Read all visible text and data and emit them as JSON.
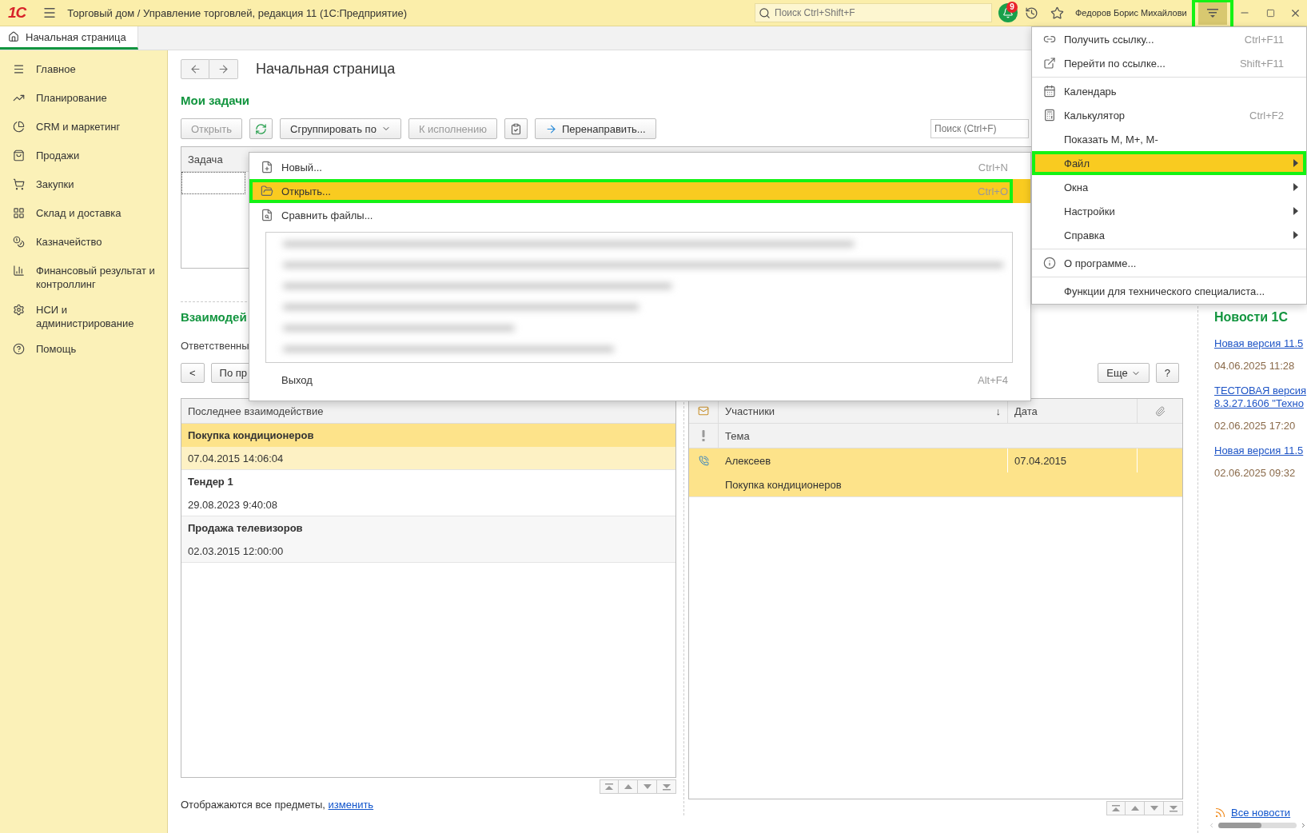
{
  "titlebar": {
    "logo": "1С",
    "title": "Торговый дом / Управление торговлей, редакция 11  (1С:Предприятие)",
    "search": {
      "placeholder": "Поиск Ctrl+Shift+F"
    },
    "notifications": "9",
    "user": "Федоров Борис Михайлови",
    "main_menu_highlighted": true
  },
  "tabs": [
    {
      "label": "Начальная страница",
      "selected": true
    }
  ],
  "sidebar": {
    "items": [
      {
        "label": "Главное"
      },
      {
        "label": "Планирование"
      },
      {
        "label": "CRM и маркетинг"
      },
      {
        "label": "Продажи"
      },
      {
        "label": "Закупки"
      },
      {
        "label": "Склад и доставка"
      },
      {
        "label": "Казначейство"
      },
      {
        "label": "Финансовый результат и контроллинг"
      },
      {
        "label": "НСИ и администрирование"
      },
      {
        "label": "Помощь"
      }
    ]
  },
  "page": {
    "title": "Начальная страница"
  },
  "tasks": {
    "heading": "Мои задачи",
    "toolbar": [
      {
        "kind": "button",
        "label": "Открыть",
        "disabled": true
      },
      {
        "kind": "refresh"
      },
      {
        "kind": "dropdown",
        "label": "Сгруппировать по",
        "disabled": false
      },
      {
        "kind": "button",
        "label": "К исполнению",
        "disabled": true
      },
      {
        "kind": "clipboard"
      },
      {
        "kind": "forward",
        "label": "Перенаправить...",
        "disabled": false
      }
    ],
    "search": {
      "placeholder": "Поиск (Ctrl+F)"
    },
    "columns": [
      "Задача"
    ]
  },
  "interactions": {
    "heading": "Взаимодей",
    "responsible_label": "Ответственны",
    "back_button": "<",
    "filter_button": "По пр",
    "more_button": "Еще",
    "help_button": "?",
    "subjects": {
      "column": "Последнее взаимодействие",
      "rows": [
        {
          "title": "Покупка кондиционеров",
          "date": "07.04.2015 14:06:04",
          "selected": true
        },
        {
          "title": "Тендер 1",
          "date": "29.08.2023 9:40:08",
          "selected": false
        },
        {
          "title": "Продажа телевизоров",
          "date": "02.03.2015 12:00:00",
          "selected": false
        }
      ]
    },
    "list": {
      "columns": [
        "Участники",
        "Дата"
      ],
      "sort_mark": "↓",
      "subcolumn": "Тема",
      "rows": [
        {
          "participants": "Алексеев",
          "date": "07.04.2015",
          "subject": "Покупка кондиционеров",
          "selected": true
        }
      ]
    },
    "footer": {
      "text": "Отображаются все предметы, ",
      "link": "изменить"
    }
  },
  "news": {
    "heading": "Новости 1С",
    "items": [
      {
        "lines": [
          "Новая версия 11.5"
        ],
        "date": "04.06.2025 11:28"
      },
      {
        "lines": [
          "ТЕСТОВАЯ версия",
          "8.3.27.1606 \"Техно"
        ],
        "date": "02.06.2025 17:20"
      },
      {
        "lines": [
          "Новая версия 11.5"
        ],
        "date": "02.06.2025 09:32"
      }
    ],
    "all_link": "Все новости"
  },
  "file_menu": {
    "items": [
      {
        "kind": "new",
        "label": "Новый...",
        "shortcut": "Ctrl+N",
        "selected": false,
        "highlighted": false
      },
      {
        "kind": "open",
        "label": "Открыть...",
        "shortcut": "Ctrl+O",
        "selected": true,
        "highlighted": true
      },
      {
        "kind": "compare",
        "label": "Сравнить файлы...",
        "selected": false,
        "highlighted": false
      },
      {
        "kind": "recent"
      },
      {
        "kind": "plain",
        "label": "Выход",
        "shortcut": "Alt+F4",
        "selected": false,
        "highlighted": false
      }
    ]
  },
  "main_menu": {
    "items": [
      {
        "kind": "link",
        "label": "Получить ссылку...",
        "shortcut": "Ctrl+F11",
        "selected": false,
        "highlighted": false
      },
      {
        "kind": "goto",
        "label": "Перейти по ссылке...",
        "shortcut": "Shift+F11",
        "selected": false,
        "highlighted": false
      },
      {
        "kind": "separator"
      },
      {
        "kind": "calendar",
        "label": "Календарь",
        "selected": false,
        "highlighted": false
      },
      {
        "kind": "calculator",
        "label": "Калькулятор",
        "shortcut": "Ctrl+F2",
        "selected": false,
        "highlighted": false
      },
      {
        "kind": "plain",
        "label": "Показать М, М+, М-",
        "selected": false,
        "highlighted": false
      },
      {
        "kind": "submenu",
        "label": "Файл",
        "selected": true,
        "highlighted": true
      },
      {
        "kind": "submenu",
        "label": "Окна",
        "selected": false,
        "highlighted": false
      },
      {
        "kind": "submenu",
        "label": "Настройки",
        "selected": false,
        "highlighted": false
      },
      {
        "kind": "submenu",
        "label": "Справка",
        "selected": false,
        "highlighted": false
      },
      {
        "kind": "separator"
      },
      {
        "kind": "info",
        "label": "О программе...",
        "selected": false,
        "highlighted": false
      },
      {
        "kind": "separator"
      },
      {
        "kind": "plain",
        "label": "Функции для технического специалиста...",
        "selected": false,
        "highlighted": false
      }
    ]
  }
}
